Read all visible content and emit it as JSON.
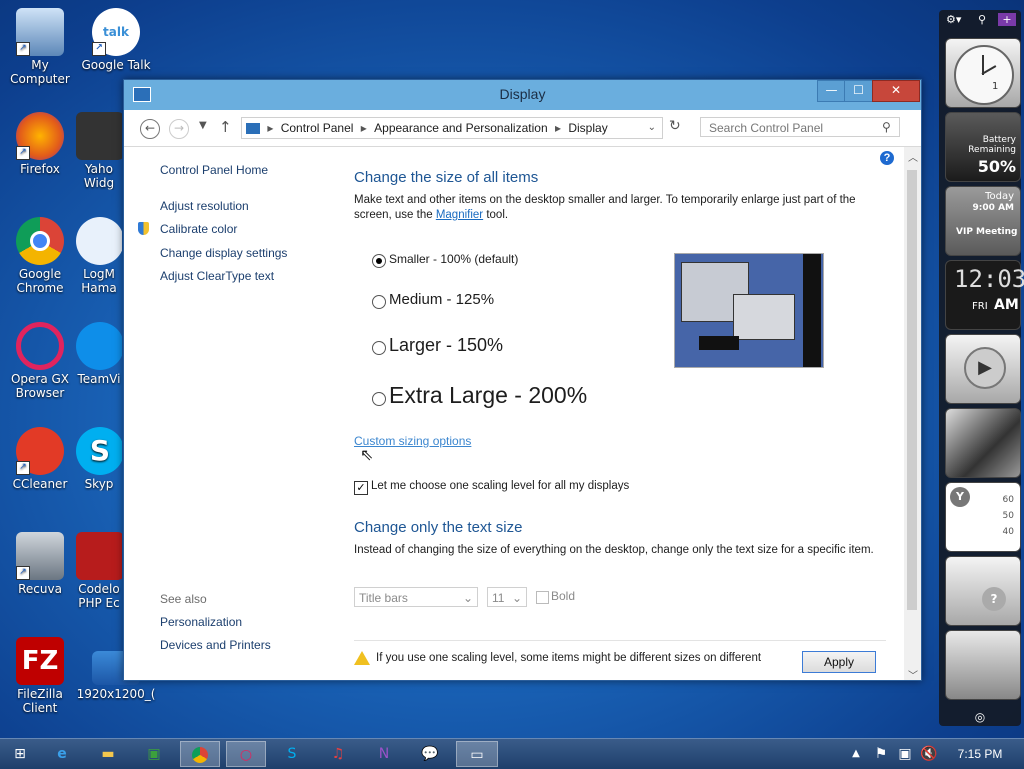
{
  "desktop": {
    "icons": [
      {
        "label": "My Computer"
      },
      {
        "label": "Google Talk"
      },
      {
        "label": "Firefox"
      },
      {
        "label": "Yaho Widg"
      },
      {
        "label": "Google Chrome"
      },
      {
        "label": "LogM Hama"
      },
      {
        "label": "Opera GX Browser"
      },
      {
        "label": "TeamVi"
      },
      {
        "label": "CCleaner"
      },
      {
        "label": "Skyp"
      },
      {
        "label": "Recuva"
      },
      {
        "label": "Codelo PHP Ec"
      },
      {
        "label": "FileZilla Client"
      },
      {
        "label": "1920x1200_("
      }
    ]
  },
  "window": {
    "title": "Display",
    "minimize": "—",
    "maximize": "☐",
    "close": "✕",
    "breadcrumb": [
      "Control Panel",
      "Appearance and Personalization",
      "Display"
    ],
    "search_placeholder": "Search Control Panel"
  },
  "sidebar": {
    "home": "Control Panel Home",
    "items": [
      "Adjust resolution",
      "Calibrate color",
      "Change display settings",
      "Adjust ClearType text"
    ],
    "see_also": "See also",
    "see_also_items": [
      "Personalization",
      "Devices and Printers"
    ]
  },
  "main": {
    "heading1": "Change the size of all items",
    "desc1_a": "Make text and other items on the desktop smaller and larger. To temporarily enlarge just part of the screen, use the ",
    "desc1_link": "Magnifier",
    "desc1_b": " tool.",
    "options": [
      {
        "label": "Smaller - 100% (default)",
        "selected": true
      },
      {
        "label": "Medium - 125%",
        "selected": false
      },
      {
        "label": "Larger - 150%",
        "selected": false
      },
      {
        "label": "Extra Large - 200%",
        "selected": false
      }
    ],
    "custom_link": "Custom sizing options",
    "checkbox_label": "Let me choose one scaling level for all my displays",
    "checkbox_checked": true,
    "heading2": "Change only the text size",
    "desc2": "Instead of changing the size of everything on the desktop, change only the text size for a specific item.",
    "text_item_select": "Title bars",
    "text_size_select": "11",
    "bold_label": "Bold",
    "warning": "If you use one scaling level, some items might be different sizes on different displays.",
    "apply": "Apply"
  },
  "taskbar": {
    "clock": "7:15 PM"
  },
  "gadgets": {
    "battery_label": "Battery Remaining",
    "battery_value": "50%",
    "calendar_day": "Today",
    "calendar_time": "9:00 AM",
    "calendar_event": "VIP Meeting",
    "clock_time": "12:03",
    "clock_day": "FRI",
    "clock_ampm": "AM",
    "clock_date": "1",
    "stock_ticks": [
      "60",
      "50",
      "40"
    ]
  }
}
